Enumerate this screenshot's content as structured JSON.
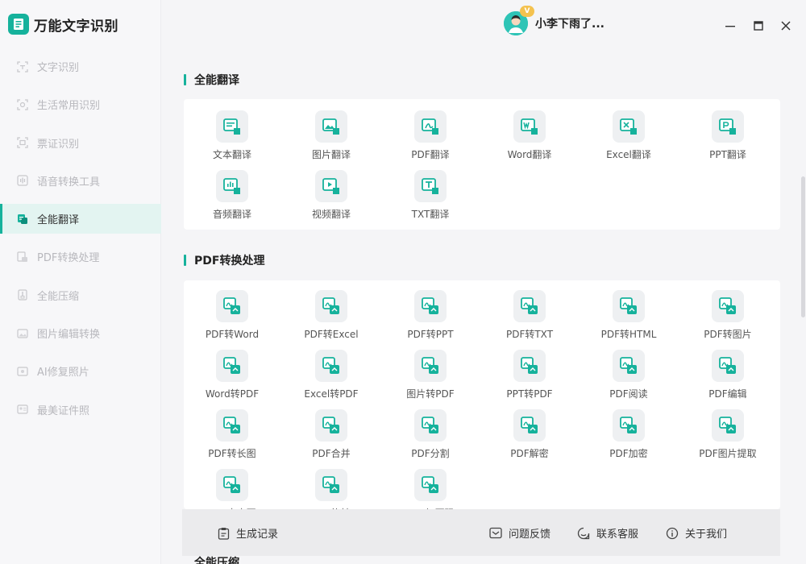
{
  "app": {
    "title": "万能文字识别"
  },
  "sidebar": {
    "items": [
      {
        "label": "文字识别",
        "icon": "text-scan-icon"
      },
      {
        "label": "生活常用识别",
        "icon": "life-scan-icon"
      },
      {
        "label": "票证识别",
        "icon": "ticket-scan-icon"
      },
      {
        "label": "语音转换工具",
        "icon": "voice-convert-icon"
      },
      {
        "label": "全能翻译",
        "icon": "translate-icon",
        "active": true
      },
      {
        "label": "PDF转换处理",
        "icon": "pdf-icon"
      },
      {
        "label": "全能压缩",
        "icon": "compress-icon"
      },
      {
        "label": "图片编辑转换",
        "icon": "image-edit-icon"
      },
      {
        "label": "AI修复照片",
        "icon": "ai-repair-icon"
      },
      {
        "label": "最美证件照",
        "icon": "id-photo-icon"
      }
    ]
  },
  "header": {
    "username": "小李下雨了...",
    "vip_badge": "V"
  },
  "sections": {
    "translate": {
      "title": "全能翻译",
      "tools": [
        "文本翻译",
        "图片翻译",
        "PDF翻译",
        "Word翻译",
        "Excel翻译",
        "PPT翻译",
        "音频翻译",
        "视频翻译",
        "TXT翻译"
      ]
    },
    "pdf": {
      "title": "PDF转换处理",
      "tools": [
        "PDF转Word",
        "PDF转Excel",
        "PDF转PPT",
        "PDF转TXT",
        "PDF转HTML",
        "PDF转图片",
        "Word转PDF",
        "Excel转PDF",
        "图片转PDF",
        "PPT转PDF",
        "PDF阅读",
        "PDF编辑",
        "PDF转长图",
        "PDF合并",
        "PDF分割",
        "PDF解密",
        "PDF加密",
        "PDF图片提取",
        "PDF去内页",
        "PDF旋转",
        "PDF加页码"
      ]
    },
    "compress": {
      "title": "全能压缩"
    }
  },
  "footer": {
    "records": "生成记录",
    "feedback": "问题反馈",
    "service": "联系客服",
    "about": "关于我们"
  },
  "colors": {
    "accent": "#16b29c"
  }
}
